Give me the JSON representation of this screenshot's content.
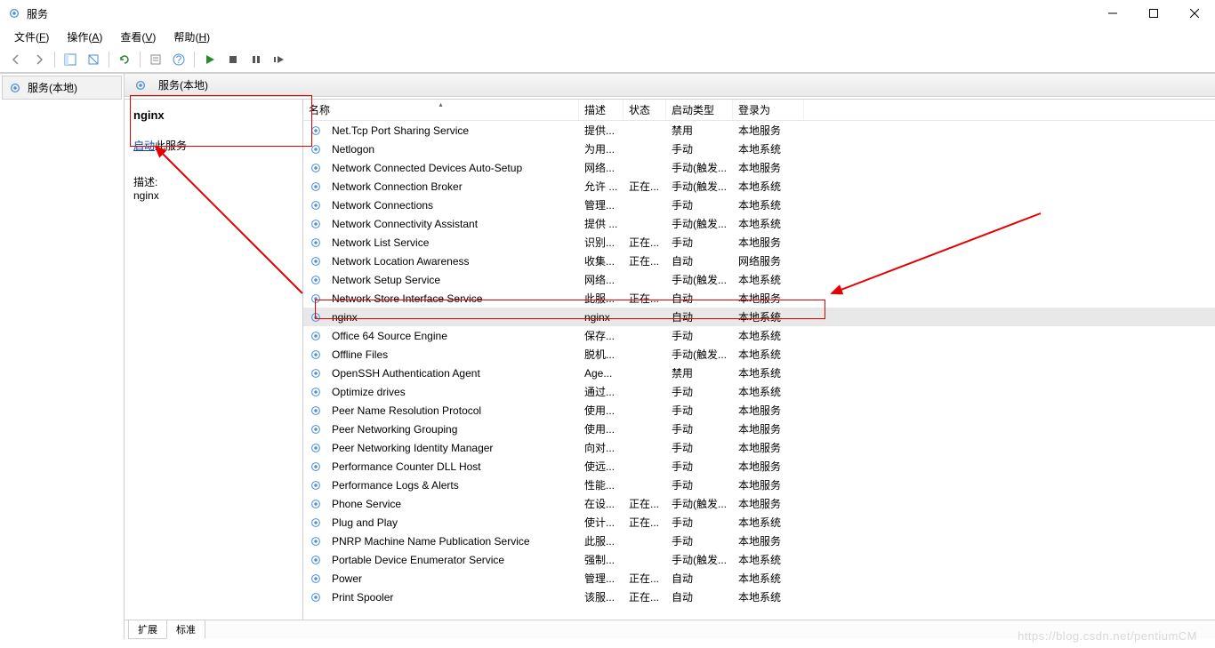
{
  "window": {
    "title": "服务",
    "tree_item": "服务(本地)",
    "content_header": "服务(本地)"
  },
  "menubar": [
    {
      "label": "文件",
      "key": "F"
    },
    {
      "label": "操作",
      "key": "A"
    },
    {
      "label": "查看",
      "key": "V"
    },
    {
      "label": "帮助",
      "key": "H"
    }
  ],
  "detail": {
    "service_title": "nginx",
    "start_link": "启动",
    "start_suffix": "此服务",
    "desc_label": "描述:",
    "desc_value": "nginx"
  },
  "columns": {
    "name": "名称",
    "desc": "描述",
    "status": "状态",
    "startup": "启动类型",
    "logon": "登录为"
  },
  "tabs": {
    "extended": "扩展",
    "standard": "标准"
  },
  "services": [
    {
      "name": "Net.Tcp Port Sharing Service",
      "desc": "提供...",
      "status": "",
      "startup": "禁用",
      "logon": "本地服务"
    },
    {
      "name": "Netlogon",
      "desc": "为用...",
      "status": "",
      "startup": "手动",
      "logon": "本地系统"
    },
    {
      "name": "Network Connected Devices Auto-Setup",
      "desc": "网络...",
      "status": "",
      "startup": "手动(触发...",
      "logon": "本地服务"
    },
    {
      "name": "Network Connection Broker",
      "desc": "允许 ...",
      "status": "正在...",
      "startup": "手动(触发...",
      "logon": "本地系统"
    },
    {
      "name": "Network Connections",
      "desc": "管理...",
      "status": "",
      "startup": "手动",
      "logon": "本地系统"
    },
    {
      "name": "Network Connectivity Assistant",
      "desc": "提供 ...",
      "status": "",
      "startup": "手动(触发...",
      "logon": "本地系统"
    },
    {
      "name": "Network List Service",
      "desc": "识别...",
      "status": "正在...",
      "startup": "手动",
      "logon": "本地服务"
    },
    {
      "name": "Network Location Awareness",
      "desc": "收集...",
      "status": "正在...",
      "startup": "自动",
      "logon": "网络服务"
    },
    {
      "name": "Network Setup Service",
      "desc": "网络...",
      "status": "",
      "startup": "手动(触发...",
      "logon": "本地系统"
    },
    {
      "name": "Network Store Interface Service",
      "desc": "此服...",
      "status": "正在...",
      "startup": "自动",
      "logon": "本地服务"
    },
    {
      "name": "nginx",
      "desc": "nginx",
      "status": "",
      "startup": "自动",
      "logon": "本地系统",
      "selected": true
    },
    {
      "name": "Office 64 Source Engine",
      "desc": "保存...",
      "status": "",
      "startup": "手动",
      "logon": "本地系统"
    },
    {
      "name": "Offline Files",
      "desc": "脱机...",
      "status": "",
      "startup": "手动(触发...",
      "logon": "本地系统"
    },
    {
      "name": "OpenSSH Authentication Agent",
      "desc": "Age...",
      "status": "",
      "startup": "禁用",
      "logon": "本地系统"
    },
    {
      "name": "Optimize drives",
      "desc": "通过...",
      "status": "",
      "startup": "手动",
      "logon": "本地系统"
    },
    {
      "name": "Peer Name Resolution Protocol",
      "desc": "使用...",
      "status": "",
      "startup": "手动",
      "logon": "本地服务"
    },
    {
      "name": "Peer Networking Grouping",
      "desc": "使用...",
      "status": "",
      "startup": "手动",
      "logon": "本地服务"
    },
    {
      "name": "Peer Networking Identity Manager",
      "desc": "向对...",
      "status": "",
      "startup": "手动",
      "logon": "本地服务"
    },
    {
      "name": "Performance Counter DLL Host",
      "desc": "使远...",
      "status": "",
      "startup": "手动",
      "logon": "本地服务"
    },
    {
      "name": "Performance Logs & Alerts",
      "desc": "性能...",
      "status": "",
      "startup": "手动",
      "logon": "本地服务"
    },
    {
      "name": "Phone Service",
      "desc": "在设...",
      "status": "正在...",
      "startup": "手动(触发...",
      "logon": "本地服务"
    },
    {
      "name": "Plug and Play",
      "desc": "使计...",
      "status": "正在...",
      "startup": "手动",
      "logon": "本地系统"
    },
    {
      "name": "PNRP Machine Name Publication Service",
      "desc": "此服...",
      "status": "",
      "startup": "手动",
      "logon": "本地服务"
    },
    {
      "name": "Portable Device Enumerator Service",
      "desc": "强制...",
      "status": "",
      "startup": "手动(触发...",
      "logon": "本地系统"
    },
    {
      "name": "Power",
      "desc": "管理...",
      "status": "正在...",
      "startup": "自动",
      "logon": "本地系统"
    },
    {
      "name": "Print Spooler",
      "desc": "该服...",
      "status": "正在...",
      "startup": "自动",
      "logon": "本地系统"
    }
  ],
  "watermark": "https://blog.csdn.net/pentiumCM"
}
